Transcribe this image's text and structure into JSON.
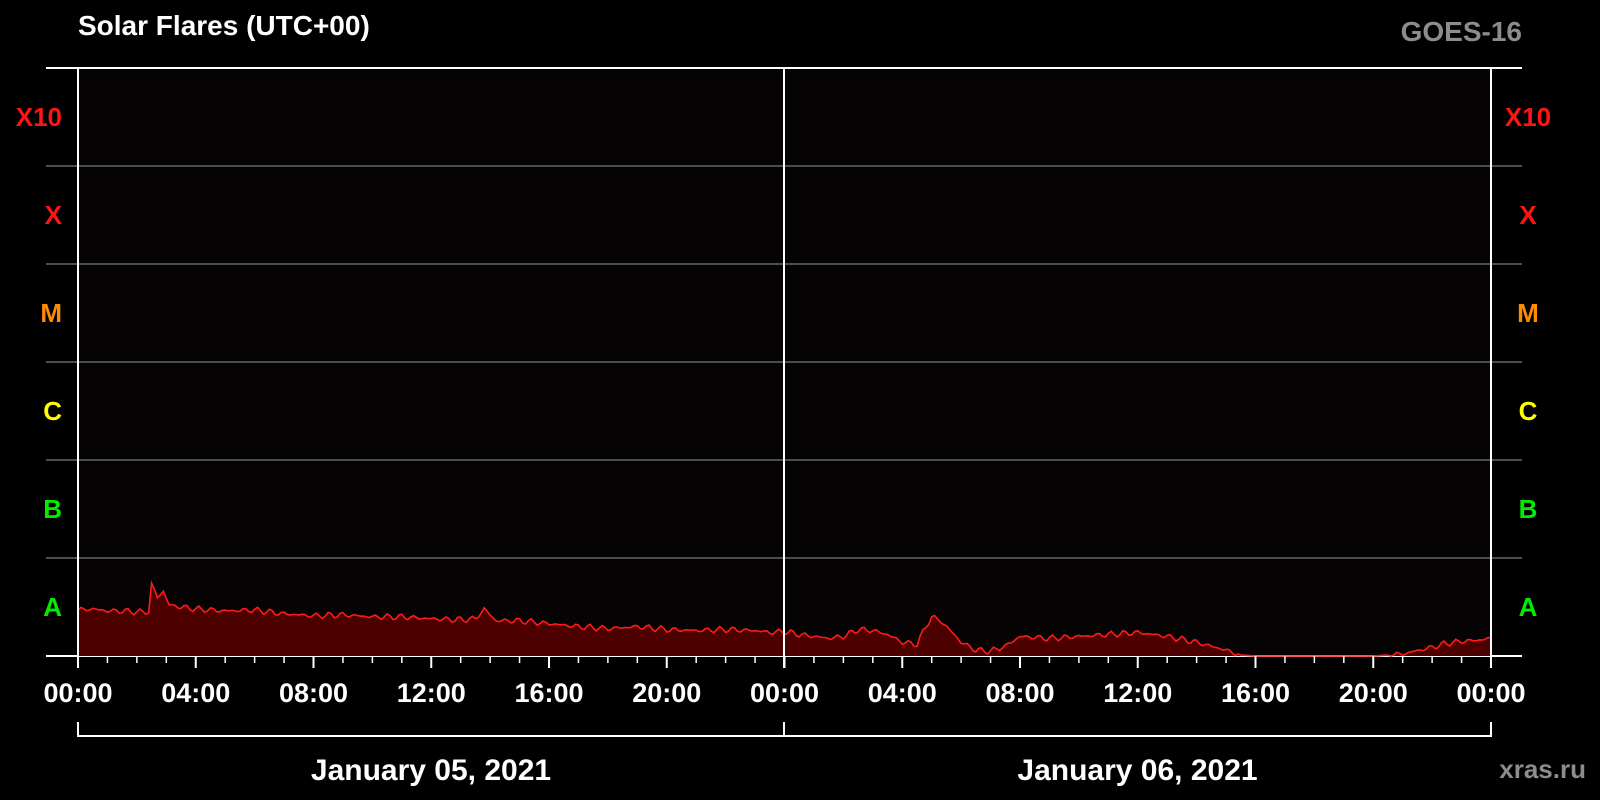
{
  "header": {
    "title": "Solar Flares (UTC+00)",
    "satellite": "GOES-16",
    "credit": "xras.ru"
  },
  "colors": {
    "background": "#000000",
    "frame": "#ffffff",
    "grid": "#666666",
    "series_line": "#ff1a1a",
    "series_fill": "#4d0000",
    "X10": "#ff1414",
    "X": "#ff1414",
    "M": "#ff8c00",
    "C": "#ffff00",
    "B": "#00ee00",
    "A": "#00ee00"
  },
  "chart_data": {
    "type": "area",
    "y_scale": "log",
    "y_unit_note": "class bands, lowest band = A, highest = X10",
    "class_labels": [
      "A",
      "B",
      "C",
      "M",
      "X",
      "X10"
    ],
    "ylim_bands": [
      0,
      6
    ],
    "x_tick_labels": [
      "00:00",
      "04:00",
      "08:00",
      "12:00",
      "16:00",
      "20:00",
      "00:00",
      "04:00",
      "08:00",
      "12:00",
      "16:00",
      "20:00",
      "00:00"
    ],
    "xlim_hours": [
      0,
      48
    ],
    "dates": [
      "January 05, 2021",
      "January 06, 2021"
    ],
    "grid": true,
    "series": [
      {
        "x_hours": [
          0,
          0.5,
          1,
          1.5,
          2,
          2.4,
          2.5,
          2.7,
          2.9,
          3.1,
          3.5,
          4,
          5,
          6,
          7,
          8,
          9,
          10,
          11,
          12,
          13,
          13.5,
          13.8,
          14.2,
          15,
          16,
          17,
          18,
          19,
          20,
          21,
          22,
          23,
          23.5,
          24,
          24.5,
          25,
          25.5,
          26,
          26.5,
          27,
          27.5,
          28,
          28.5,
          28.8,
          29,
          29.3,
          29.7,
          30,
          30.5,
          31,
          31.5,
          32,
          33,
          34,
          35,
          36,
          37,
          38,
          39,
          39.5,
          40,
          40.5,
          41,
          42,
          43,
          44,
          45,
          46,
          46.5,
          47,
          47.5,
          48
        ],
        "band_values": [
          0.47,
          0.48,
          0.46,
          0.46,
          0.45,
          0.45,
          0.73,
          0.6,
          0.66,
          0.52,
          0.5,
          0.48,
          0.46,
          0.47,
          0.43,
          0.41,
          0.42,
          0.4,
          0.4,
          0.38,
          0.37,
          0.38,
          0.48,
          0.36,
          0.36,
          0.33,
          0.3,
          0.28,
          0.3,
          0.27,
          0.26,
          0.27,
          0.26,
          0.24,
          0.25,
          0.22,
          0.2,
          0.18,
          0.2,
          0.27,
          0.26,
          0.22,
          0.14,
          0.12,
          0.3,
          0.4,
          0.36,
          0.24,
          0.14,
          0.06,
          0.05,
          0.1,
          0.2,
          0.18,
          0.2,
          0.22,
          0.24,
          0.2,
          0.14,
          0.06,
          0.01,
          0.0,
          0.0,
          0.0,
          0.0,
          0.0,
          0.0,
          0.02,
          0.09,
          0.13,
          0.15,
          0.16,
          0.18
        ]
      }
    ]
  }
}
